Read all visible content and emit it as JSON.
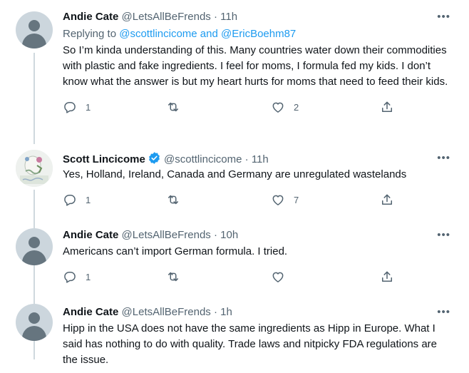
{
  "tweets": [
    {
      "name": "Andie Cate",
      "handle": "@LetsAllBeFrends",
      "time": "11h",
      "replying_prefix": "Replying to",
      "replying_to": "@scottlincicome and @EricBoehm87",
      "text": "So I’m kinda understanding of this. Many countries water down their commodities with plastic and fake ingredients. I feel for moms, I formula fed my kids. I don’t know what the answer is but my heart hurts for moms that need to feed their kids.",
      "replies": "1",
      "likes": "2"
    },
    {
      "name": "Scott Lincicome",
      "handle": "@scottlincicome",
      "time": "11h",
      "text": "Yes, Holland, Ireland, Canada and Germany are unregulated wastelands",
      "replies": "1",
      "likes": "7"
    },
    {
      "name": "Andie Cate",
      "handle": "@LetsAllBeFrends",
      "time": "10h",
      "text": "Americans can’t import German formula. I tried.",
      "replies": "1",
      "likes": ""
    },
    {
      "name": "Andie Cate",
      "handle": "@LetsAllBeFrends",
      "time": "1h",
      "text": "Hipp in the USA does not have the same ingredients as Hipp in Europe. What I said has nothing to do with quality. Trade laws and nitpicky FDA regulations are the issue."
    }
  ],
  "separator": "·",
  "more_glyph": "•••",
  "colors": {
    "link": "#1d9bf0",
    "verified": "#1d9bf0",
    "secondary": "#536471"
  }
}
